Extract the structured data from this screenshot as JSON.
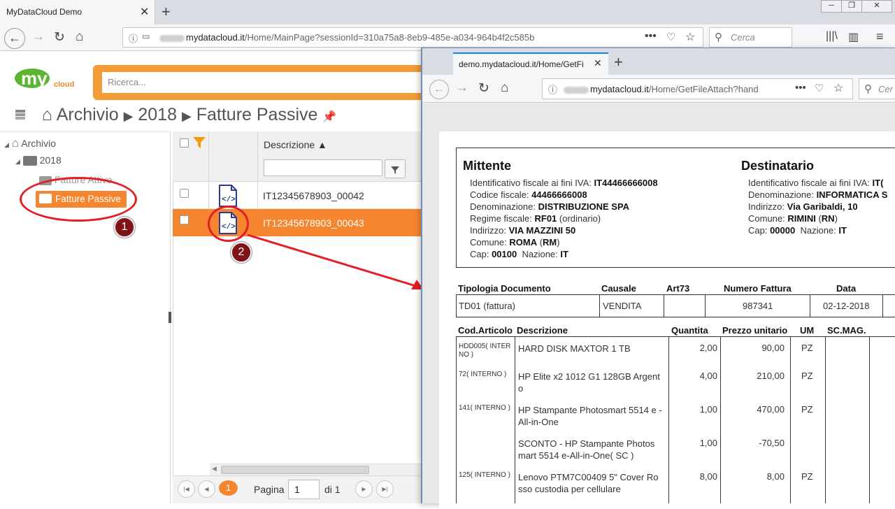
{
  "browser": {
    "tab_title": "MyDataCloud Demo",
    "url_domain": "mydatacloud.it",
    "url_path": "/Home/MainPage?sessionId=310a75a8-8eb9-485e-a034-964b4f2c585b",
    "search_placeholder": "Cerca"
  },
  "app": {
    "logo_text": "my",
    "logo_sub": "cloud",
    "search_placeholder": "Ricerca...",
    "breadcrumb": [
      "Archivio",
      "2018",
      "Fatture Passive"
    ]
  },
  "tree": {
    "root": "Archivio",
    "year": "2018",
    "folder1": "Fatture Attive",
    "folder2": "Fatture Passive"
  },
  "grid": {
    "col_descrizione": "Descrizione ▲",
    "rows": [
      "IT12345678903_00042",
      "IT12345678903_00043"
    ]
  },
  "pager": {
    "current": "1",
    "label": "Pagina",
    "of": "di 1",
    "input_value": "1"
  },
  "annotations": [
    "1",
    "2"
  ],
  "popup": {
    "tab_title": "demo.mydatacloud.it/Home/GetFi",
    "url_domain": "mydatacloud.it",
    "url_path": "/Home/GetFileAttach?hand",
    "search_placeholder": "Cer"
  },
  "invoice": {
    "mittente_title": "Mittente",
    "destinatario_title": "Destinatario",
    "mittente": [
      [
        "Identificativo fiscale ai fini IVA: ",
        "IT44466666008"
      ],
      [
        "Codice fiscale: ",
        "44466666008"
      ],
      [
        "Denominazione: ",
        "DISTRIBUZIONE SPA"
      ],
      [
        "Regime fiscale: ",
        "RF01",
        " (ordinario)"
      ],
      [
        "Indirizzo: ",
        "VIA MAZZINI 50"
      ],
      [
        "Comune: ",
        "ROMA",
        " (",
        "RM",
        ")"
      ],
      [
        "Cap: ",
        "00100",
        "  Nazione: ",
        "IT"
      ]
    ],
    "destinatario": [
      [
        "Identificativo fiscale ai fini IVA: ",
        "IT("
      ],
      [
        "Denominazione: ",
        "INFORMATICA S"
      ],
      [
        "Indirizzo: ",
        "Via Garibaldi, 10"
      ],
      [
        "Comune: ",
        "RIMINI",
        " (",
        "RN",
        ")"
      ],
      [
        "Cap: ",
        "00000",
        "  Nazione: ",
        "IT"
      ]
    ],
    "doc_headers": [
      "Tipologia Documento",
      "Causale",
      "Art73",
      "Numero Fattura",
      "Data"
    ],
    "doc_values": [
      "TD01 (fattura)",
      "VENDITA",
      "",
      "987341",
      "02-12-2018"
    ],
    "line_headers": [
      "Cod.Articolo",
      "Descrizione",
      "Quantita",
      "Prezzo unitario",
      "UM",
      "SC.MAG."
    ],
    "lines": [
      {
        "cod": "HDD005( INTER NO )",
        "desc": "HARD DISK MAXTOR 1 TB",
        "qty": "2,00",
        "price": "90,00",
        "um": "PZ"
      },
      {
        "cod": "72( INTERNO )",
        "desc": "HP Elite x2 1012 G1 128GB Argent o",
        "qty": "4,00",
        "price": "210,00",
        "um": "PZ"
      },
      {
        "cod": "141( INTERNO )",
        "desc": "HP Stampante Photosmart 5514 e -All-in-One",
        "qty": "1,00",
        "price": "470,00",
        "um": "PZ"
      },
      {
        "cod": "",
        "desc": "SCONTO - HP Stampante Photos mart 5514 e-All-in-One( SC )",
        "qty": "1,00",
        "price": "-70,50",
        "um": ""
      },
      {
        "cod": "125( INTERNO )",
        "desc": "Lenovo PTM7C00409 5\" Cover Ro sso custodia per cellulare",
        "qty": "8,00",
        "price": "8,00",
        "um": "PZ"
      }
    ]
  },
  "colors": {
    "accent": "#f5862f",
    "annotation": "#e31e24",
    "badge": "#7f1416"
  }
}
